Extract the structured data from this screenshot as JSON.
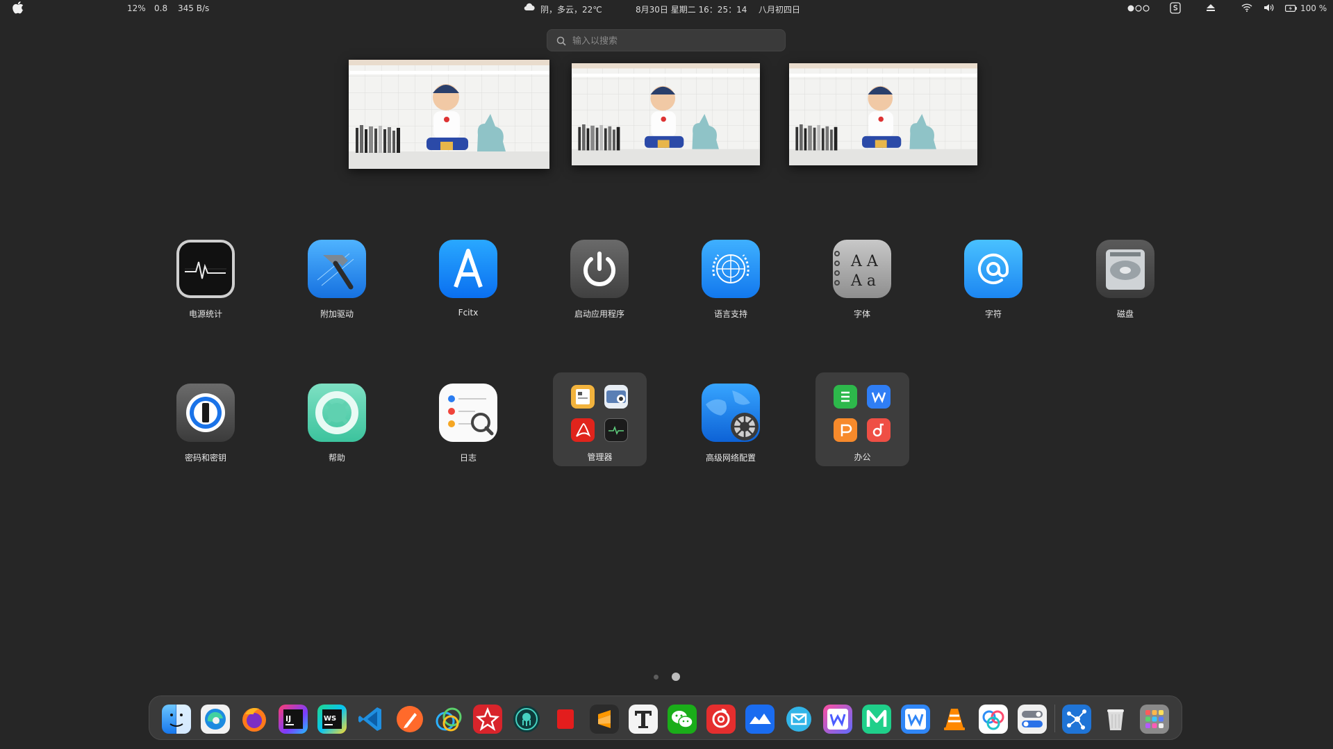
{
  "topbar": {
    "apple_icon": "apple-logo-icon",
    "cpu": "12%",
    "load": "0.8",
    "net": "345 B/s",
    "weather": "阴，多云，22℃",
    "datetime": "8月30日 星期二  16：25：14",
    "lunar": "八月初四日",
    "battery": "100 %"
  },
  "search": {
    "placeholder": "输入以搜索"
  },
  "workspaces": [
    {
      "name": "workspace-1"
    },
    {
      "name": "workspace-2"
    },
    {
      "name": "workspace-3"
    }
  ],
  "apps_row1": [
    {
      "label": "电源统计",
      "icon": "activity-monitor-icon"
    },
    {
      "label": "附加驱动",
      "icon": "hammer-icon"
    },
    {
      "label": "Fcitx",
      "icon": "fcitx-a-icon"
    },
    {
      "label": "启动应用程序",
      "icon": "power-icon"
    },
    {
      "label": "语言支持",
      "icon": "globe-icon"
    },
    {
      "label": "字体",
      "icon": "font-book-icon"
    },
    {
      "label": "字符",
      "icon": "at-sign-icon"
    },
    {
      "label": "磁盘",
      "icon": "hard-disk-icon"
    }
  ],
  "apps_row2": [
    {
      "label": "密码和密钥",
      "icon": "keyhole-icon"
    },
    {
      "label": "帮助",
      "icon": "lifebuoy-icon"
    },
    {
      "label": "日志",
      "icon": "log-list-icon"
    },
    {
      "label": "管理器",
      "icon": "folder-icon"
    },
    {
      "label": "高级网络配置",
      "icon": "network-gear-icon"
    },
    {
      "label": "办公",
      "icon": "folder-icon"
    }
  ],
  "dock": [
    "finder-icon",
    "edge-icon",
    "firefox-icon",
    "intellij-icon",
    "webstorm-icon",
    "vscode-icon",
    "pen-icon",
    "loop-icon",
    "star-icon",
    "gitkraken-icon",
    "red-box-icon",
    "sublime-icon",
    "typora-icon",
    "wechat-icon",
    "netease-music-icon",
    "cloud-icon",
    "mail-icon",
    "wps-writer-icon",
    "m-icon",
    "w-icon",
    "vlc-icon",
    "baidu-netdisk-icon",
    "settings-toggle-icon",
    "share-icon",
    "trash-icon",
    "launchpad-icon"
  ]
}
